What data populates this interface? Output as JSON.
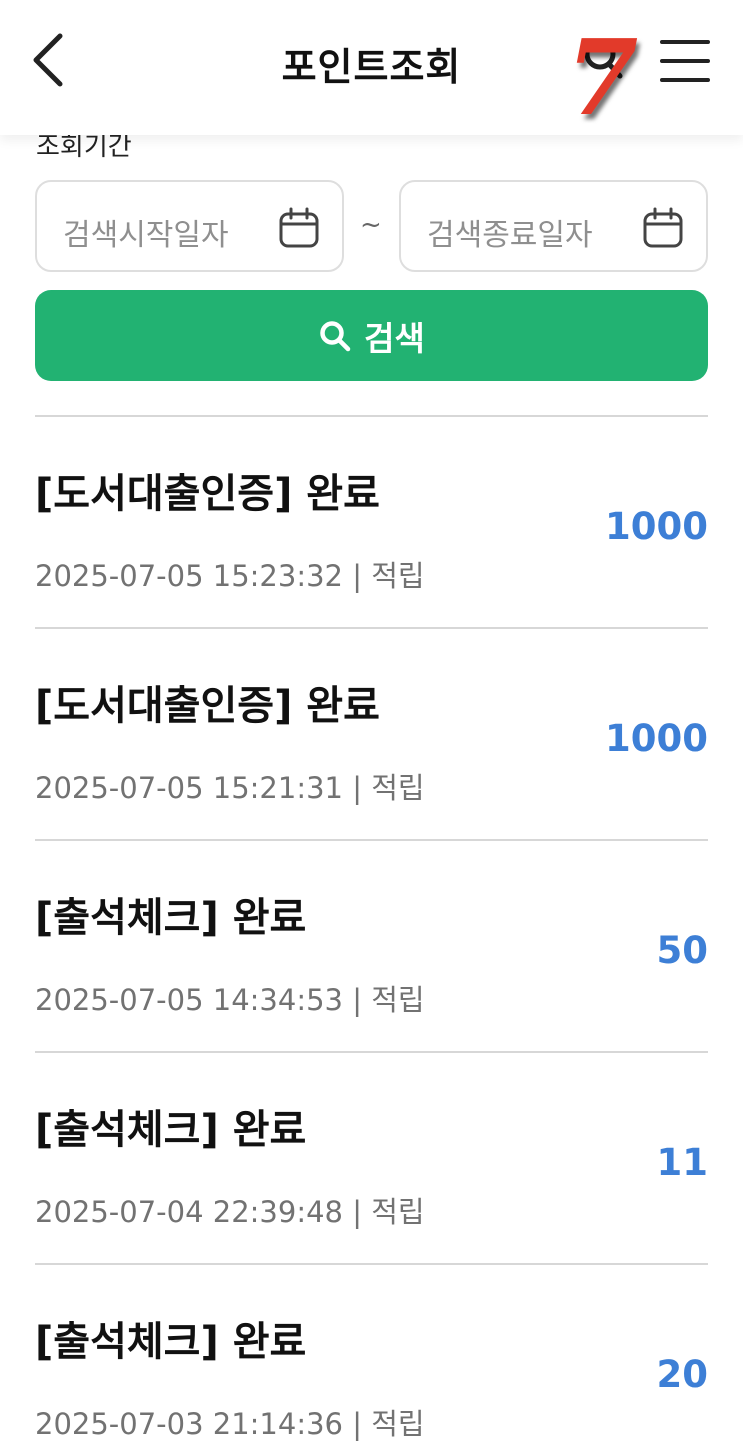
{
  "header": {
    "title": "포인트조회",
    "back_icon": "chevron-left-icon",
    "search_icon": "search-icon",
    "menu_icon": "hamburger-menu-icon",
    "overlay_badge": "7",
    "badge_color": "#e23a2a"
  },
  "filter": {
    "period_label": "조회기간",
    "start_placeholder": "검색시작일자",
    "end_placeholder": "검색종료일자",
    "separator": "~",
    "calendar_icon": "calendar-icon",
    "search_button_label": "검색",
    "search_button_color": "#22b272"
  },
  "points_color": "#3d7fd6",
  "items": [
    {
      "title": "[도서대출인증] 완료",
      "datetime": "2025-07-05 15:23:32",
      "type": "적립",
      "points": "1000"
    },
    {
      "title": "[도서대출인증] 완료",
      "datetime": "2025-07-05 15:21:31",
      "type": "적립",
      "points": "1000"
    },
    {
      "title": "[출석체크] 완료",
      "datetime": "2025-07-05 14:34:53",
      "type": "적립",
      "points": "50"
    },
    {
      "title": "[출석체크] 완료",
      "datetime": "2025-07-04 22:39:48",
      "type": "적립",
      "points": "11"
    },
    {
      "title": "[출석체크] 완료",
      "datetime": "2025-07-03 21:14:36",
      "type": "적립",
      "points": "20"
    }
  ]
}
